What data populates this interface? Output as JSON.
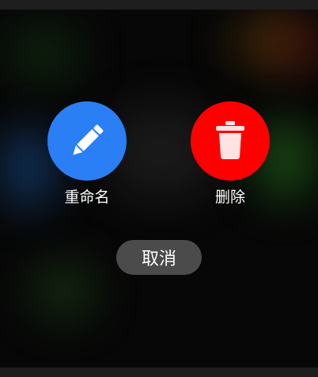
{
  "actions": {
    "rename": {
      "label": "重命名",
      "icon": "pencil-icon",
      "color": "#2a7ff5"
    },
    "delete": {
      "label": "删除",
      "icon": "trash-icon",
      "color": "#ff0000"
    }
  },
  "cancel": {
    "label": "取消"
  }
}
